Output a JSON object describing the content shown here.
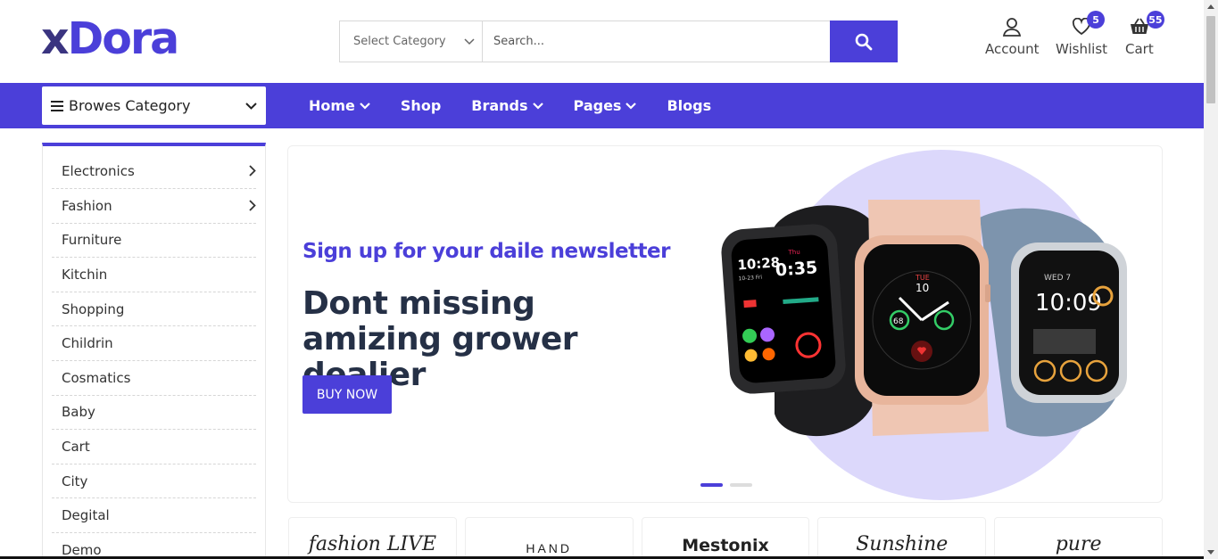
{
  "header": {
    "logo_part1": "x",
    "logo_part2": "Dora",
    "category_select": "Select Category",
    "search_placeholder": "Search...",
    "account_label": "Account",
    "wishlist_label": "Wishlist",
    "wishlist_count": "5",
    "cart_label": "Cart",
    "cart_count": "55"
  },
  "navbar": {
    "browse_label": "Browes Category",
    "items": [
      {
        "label": "Home",
        "has_dropdown": true
      },
      {
        "label": "Shop",
        "has_dropdown": false
      },
      {
        "label": "Brands",
        "has_dropdown": true
      },
      {
        "label": "Pages",
        "has_dropdown": true
      },
      {
        "label": "Blogs",
        "has_dropdown": false
      }
    ]
  },
  "sidebar": {
    "items": [
      {
        "label": "Electronics",
        "has_submenu": true
      },
      {
        "label": "Fashion",
        "has_submenu": true
      },
      {
        "label": "Furniture"
      },
      {
        "label": "Kitchin"
      },
      {
        "label": "Shopping"
      },
      {
        "label": "Childrin"
      },
      {
        "label": "Cosmatics"
      },
      {
        "label": "Baby"
      },
      {
        "label": "Cart"
      },
      {
        "label": "City"
      },
      {
        "label": "Degital"
      },
      {
        "label": "Demo"
      }
    ]
  },
  "hero": {
    "subtitle": "Sign up for your daile newsletter",
    "title": "Dont missing amizing grower dealier",
    "button": "BUY NOW",
    "watch1": {
      "time": "10:28",
      "time2": "0:35",
      "day": "Thu",
      "date": "10-23 Fri"
    },
    "watch2": {
      "day": "TUE",
      "date": "10",
      "ring": "68"
    },
    "watch3": {
      "time": "10:09",
      "day": "WED 7"
    },
    "active_slide": 1,
    "slide_count": 2
  },
  "brands": [
    {
      "name": "fashion LIVE"
    },
    {
      "name": "HAND"
    },
    {
      "name": "Mestonix"
    },
    {
      "name": "Sunshine"
    },
    {
      "name": "pure"
    }
  ],
  "colors": {
    "accent": "#4b3fd9",
    "dark_text": "#253046",
    "circle": "#dcd8fb"
  }
}
